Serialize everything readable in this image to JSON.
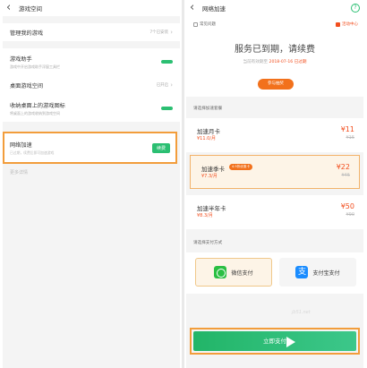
{
  "left": {
    "topbar": {
      "title": "游戏空间"
    },
    "manage": {
      "label": "管理我的游戏",
      "count": "7个已安装"
    },
    "assistant": {
      "title": "游戏助手",
      "desc": "游戏中开启游戏助手浮窗工具栏"
    },
    "desktop_space": {
      "label": "桌面游戏空间",
      "status": "已开启"
    },
    "desktop_icon": {
      "title": "收纳桌面上的游戏图标",
      "desc": "将桌面上的游戏收纳到游戏空间"
    },
    "accel": {
      "title": "网络加速",
      "desc": "已过期，续费后即可加速游戏",
      "badge": "续费"
    },
    "more": {
      "label": "更多详情"
    }
  },
  "right": {
    "topbar": {
      "title": "网络加速"
    },
    "note": "常见问题",
    "gift_link": "活动中心",
    "status_title": "服务已到期，请续费",
    "expiry_prefix": "当前有效期至",
    "expiry_date": "2018-07-16",
    "expiry_state": "已过期",
    "join_button": "参与抽奖",
    "plans_label": "请选择加速套餐",
    "plans": [
      {
        "name": "加速月卡",
        "monthly": "¥11.0/月",
        "price": "¥11",
        "original": "¥15"
      },
      {
        "name": "加速季卡",
        "monthly": "¥7.3/月",
        "price": "¥22",
        "original": "¥45",
        "ribbon": "4.9折优惠卡"
      },
      {
        "name": "加速半年卡",
        "monthly": "¥8.3/月",
        "price": "¥50",
        "original": "¥90"
      }
    ],
    "pay_label": "请选择支付方式",
    "pay_methods": [
      {
        "label": "微信支付"
      },
      {
        "label": "支付宝支付"
      }
    ],
    "pay_button": "立即支付",
    "watermark": "jb51.net"
  },
  "colors": {
    "accent_green": "#2bbf72",
    "accent_orange": "#f29d3b",
    "price_red": "#f24e1e"
  }
}
